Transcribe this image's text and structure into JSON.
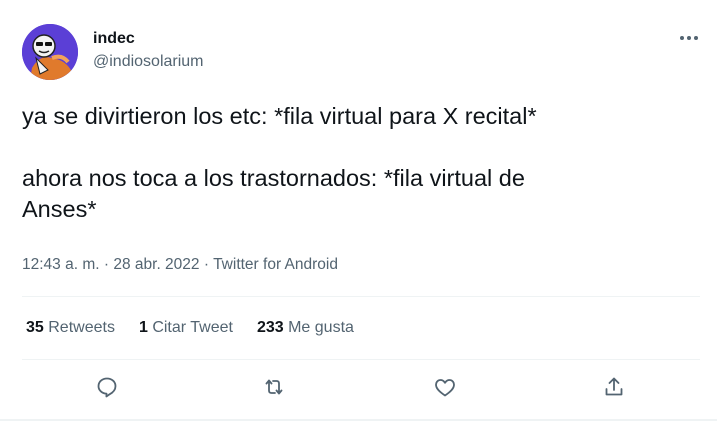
{
  "author": {
    "name": "indec",
    "handle": "@indiosolarium"
  },
  "tweet": {
    "line1": "ya se divirtieron los etc: *fila virtual para X recital*",
    "line2": "ahora nos toca a los trastornados: *fila virtual de",
    "line3": "Anses*"
  },
  "meta": {
    "time": "12:43 a. m.",
    "sep1": "·",
    "date": "28 abr. 2022",
    "sep2": "·",
    "source": "Twitter for Android"
  },
  "stats": {
    "retweets_count": "35",
    "retweets_label": "Retweets",
    "quotes_count": "1",
    "quotes_label": "Citar Tweet",
    "likes_count": "233",
    "likes_label": "Me gusta"
  },
  "icons": {
    "more": "more-horizontal-icon",
    "reply": "reply-icon",
    "retweet": "retweet-icon",
    "like": "like-icon",
    "share": "share-icon"
  },
  "colors": {
    "text": "#0f1419",
    "secondary": "#536471",
    "divider": "#eff3f4",
    "avatar_bg": "#5b3fd6"
  }
}
